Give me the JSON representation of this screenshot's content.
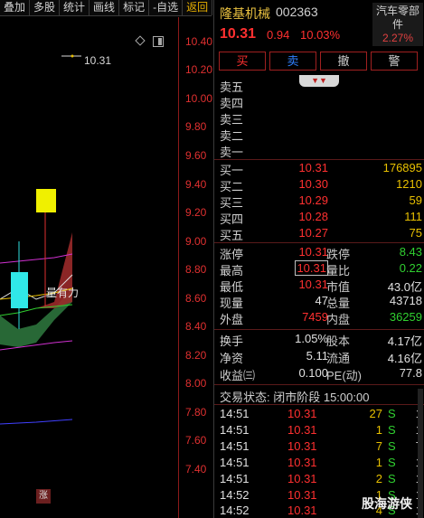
{
  "toolbar": {
    "items": [
      "叠加",
      "多股",
      "统计",
      "画线",
      "标记",
      "-自选",
      "返回"
    ]
  },
  "chart": {
    "y_ticks": [
      "10.40",
      "10.20",
      "10.00",
      "9.80",
      "9.60",
      "9.40",
      "9.20",
      "9.00",
      "8.80",
      "8.60",
      "8.40",
      "8.20",
      "8.00",
      "7.80",
      "7.60",
      "7.40"
    ],
    "price_marker": "10.31",
    "annotation": "量有力",
    "zhang_label": "涨"
  },
  "header": {
    "name": "隆基机械",
    "code": "002363",
    "price": "10.31",
    "change": "0.94",
    "change_pct": "10.03%",
    "sector_name": "汽车零部件",
    "sector_pct": "2.27%"
  },
  "buttons": {
    "buy": "买",
    "sell": "卖",
    "cancel": "撤",
    "alert": "警"
  },
  "asks": [
    {
      "label": "卖五",
      "price": "",
      "vol": ""
    },
    {
      "label": "卖四",
      "price": "",
      "vol": ""
    },
    {
      "label": "卖三",
      "price": "",
      "vol": ""
    },
    {
      "label": "卖二",
      "price": "",
      "vol": ""
    },
    {
      "label": "卖一",
      "price": "",
      "vol": ""
    }
  ],
  "bids": [
    {
      "label": "买一",
      "price": "10.31",
      "vol": "176895"
    },
    {
      "label": "买二",
      "price": "10.30",
      "vol": "1210"
    },
    {
      "label": "买三",
      "price": "10.29",
      "vol": "59"
    },
    {
      "label": "买四",
      "price": "10.28",
      "vol": "111"
    },
    {
      "label": "买五",
      "price": "10.27",
      "vol": "75"
    }
  ],
  "quote": {
    "limit_up_label": "涨停",
    "limit_up": "10.31",
    "limit_down_label": "跌停",
    "limit_down": "8.43",
    "high_label": "最高",
    "high": "10.31",
    "vol_ratio_label": "量比",
    "vol_ratio": "0.22",
    "low_label": "最低",
    "low": "10.31",
    "mkt_cap_label": "市值",
    "mkt_cap": "43.0亿",
    "cur_vol_label": "现量",
    "cur_vol": "47",
    "total_vol_label": "总量",
    "total_vol": "43718",
    "outer_label": "外盘",
    "outer": "7459",
    "inner_label": "内盘",
    "inner": "36259",
    "turnover_label": "换手",
    "turnover": "1.05%",
    "share_cap_label": "股本",
    "share_cap": "4.17亿",
    "nav_label": "净资",
    "nav": "5.11",
    "float_label": "流通",
    "float": "4.16亿",
    "eps_label": "收益㈢",
    "eps": "0.100",
    "pe_label": "PE(动)",
    "pe": "77.8"
  },
  "status": "交易状态: 闭市阶段 15:00:00",
  "ticks": [
    {
      "time": "14:51",
      "price": "10.31",
      "vol": "27",
      "side": "S",
      "num": "1"
    },
    {
      "time": "14:51",
      "price": "10.31",
      "vol": "1",
      "side": "S",
      "num": "1"
    },
    {
      "time": "14:51",
      "price": "10.31",
      "vol": "7",
      "side": "S",
      "num": "7"
    },
    {
      "time": "14:51",
      "price": "10.31",
      "vol": "1",
      "side": "S",
      "num": "1"
    },
    {
      "time": "14:51",
      "price": "10.31",
      "vol": "2",
      "side": "S",
      "num": "1"
    },
    {
      "time": "14:52",
      "price": "10.31",
      "vol": "1",
      "side": "S",
      "num": "1"
    },
    {
      "time": "14:52",
      "price": "10.31",
      "vol": "4",
      "side": "S",
      "num": "1"
    }
  ],
  "watermark": "股海游侠"
}
